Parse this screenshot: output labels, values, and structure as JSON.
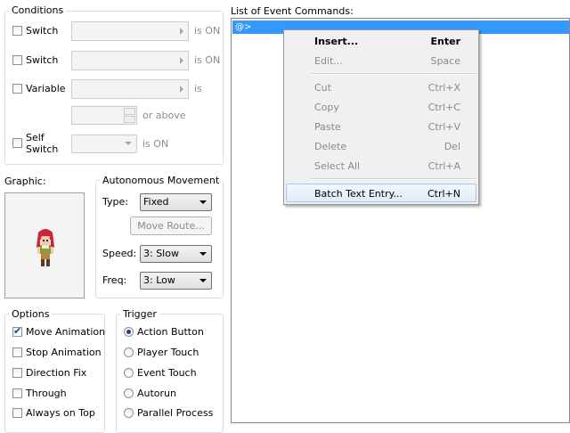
{
  "conditions": {
    "title": "Conditions",
    "switch1_label": "Switch",
    "switch1_suffix": "is ON",
    "switch2_label": "Switch",
    "switch2_suffix": "is ON",
    "variable_label": "Variable",
    "variable_suffix": "is",
    "or_above": "or above",
    "self_switch_label_1": "Self",
    "self_switch_label_2": "Switch",
    "self_switch_suffix": "is ON"
  },
  "graphic": {
    "label": "Graphic:"
  },
  "autonomous": {
    "title": "Autonomous Movement",
    "type_label": "Type:",
    "type_value": "Fixed",
    "move_route_button": "Move Route...",
    "speed_label": "Speed:",
    "speed_value": "3: Slow",
    "freq_label": "Freq:",
    "freq_value": "3: Low"
  },
  "options": {
    "title": "Options",
    "items": [
      {
        "label": "Move Animation",
        "checked": true
      },
      {
        "label": "Stop Animation",
        "checked": false
      },
      {
        "label": "Direction Fix",
        "checked": false
      },
      {
        "label": "Through",
        "checked": false
      },
      {
        "label": "Always on Top",
        "checked": false
      }
    ]
  },
  "trigger": {
    "title": "Trigger",
    "items": [
      {
        "label": "Action Button",
        "selected": true
      },
      {
        "label": "Player Touch",
        "selected": false
      },
      {
        "label": "Event Touch",
        "selected": false
      },
      {
        "label": "Autorun",
        "selected": false
      },
      {
        "label": "Parallel Process",
        "selected": false
      }
    ]
  },
  "commands": {
    "label": "List of Event Commands:",
    "first_row": "@>"
  },
  "context_menu": {
    "items": [
      {
        "label": "Insert...",
        "shortcut": "Enter",
        "disabled": false,
        "bold": true
      },
      {
        "label": "Edit...",
        "shortcut": "Space",
        "disabled": true
      },
      {
        "label": "Cut",
        "shortcut": "Ctrl+X",
        "disabled": true
      },
      {
        "label": "Copy",
        "shortcut": "Ctrl+C",
        "disabled": true
      },
      {
        "label": "Paste",
        "shortcut": "Ctrl+V",
        "disabled": true
      },
      {
        "label": "Delete",
        "shortcut": "Del",
        "disabled": true
      },
      {
        "label": "Select All",
        "shortcut": "Ctrl+A",
        "disabled": true
      },
      {
        "label": "Batch Text Entry...",
        "shortcut": "Ctrl+N",
        "disabled": false,
        "highlighted": true
      }
    ]
  },
  "colors": {
    "selection_row": "#3399ff",
    "group_border": "#d5dfe5",
    "menu_bg": "#f0f0f0"
  }
}
